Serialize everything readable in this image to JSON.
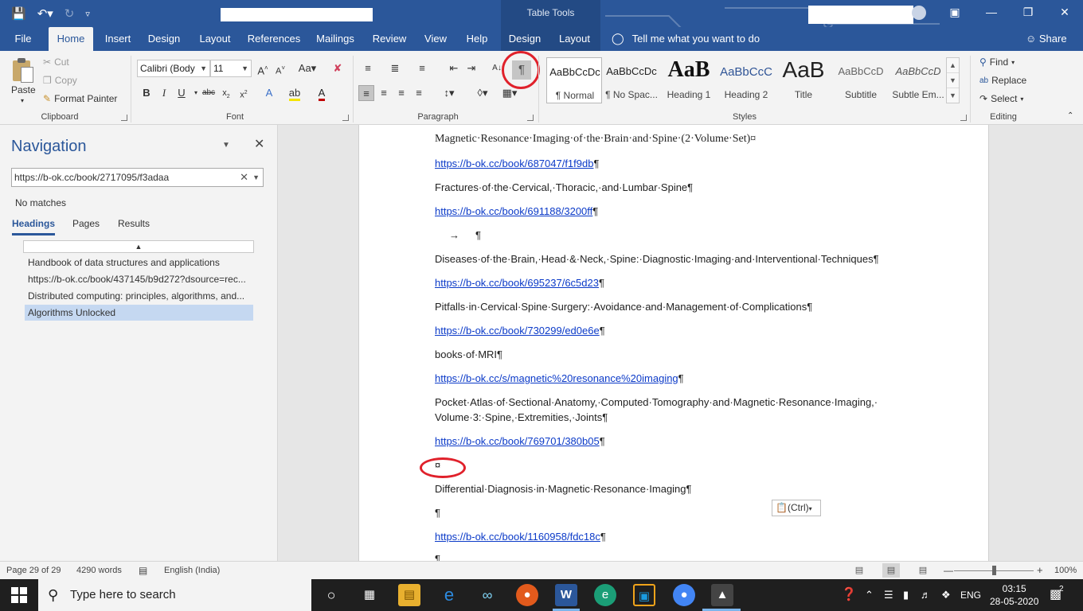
{
  "titlebar": {
    "context_group": "Table Tools",
    "undo_icon": "undo-icon",
    "redo_icon": "redo-icon"
  },
  "tabs": [
    "File",
    "Home",
    "Insert",
    "Design",
    "Layout",
    "References",
    "Mailings",
    "Review",
    "View",
    "Help",
    "Design",
    "Layout"
  ],
  "tell_me": "Tell me what you want to do",
  "share": "Share",
  "clipboard": {
    "paste": "Paste",
    "cut": "Cut",
    "copy": "Copy",
    "format_painter": "Format Painter",
    "label": "Clipboard"
  },
  "font": {
    "name": "Calibri (Body",
    "size": "11",
    "label": "Font"
  },
  "paragraph": {
    "label": "Paragraph",
    "show_marks": "¶"
  },
  "styles": {
    "label": "Styles",
    "items": [
      {
        "sample": "AaBbCcDc",
        "name": "¶ Normal"
      },
      {
        "sample": "AaBbCcDc",
        "name": "¶ No Spac..."
      },
      {
        "sample": "AaB",
        "name": "Heading 1"
      },
      {
        "sample": "AaBbCcC",
        "name": "Heading 2"
      },
      {
        "sample": "AaB",
        "name": "Title"
      },
      {
        "sample": "AaBbCcD",
        "name": "Subtitle"
      },
      {
        "sample": "AaBbCcD",
        "name": "Subtle Em..."
      }
    ]
  },
  "editing": {
    "find": "Find",
    "replace": "Replace",
    "select": "Select",
    "label": "Editing"
  },
  "navigation": {
    "title": "Navigation",
    "search_value": "https://b-ok.cc/book/2717095/f3adaa",
    "no_matches": "No matches",
    "tabs": [
      "Headings",
      "Pages",
      "Results"
    ],
    "headings": [
      "Handbook of data structures and applications",
      "https://b-ok.cc/book/437145/b9d272?dsource=rec...",
      "Distributed computing: principles, algorithms, and...",
      "Algorithms Unlocked"
    ]
  },
  "document": {
    "paragraphs": [
      {
        "text": "Magnetic·Resonance·Imaging·of·the·Brain·and·Spine·(2·Volume·Set)",
        "mark": "¤",
        "kind": "serif"
      },
      {
        "text": "https://b-ok.cc/book/687047/f1f9db",
        "mark": "¶",
        "kind": "link"
      },
      {
        "text": "Fractures·of·the·Cervical,·Thoracic,·and·Lumbar·Spine",
        "mark": "¶",
        "kind": "text"
      },
      {
        "text": "https://b-ok.cc/book/691188/3200ff",
        "mark": "¶",
        "kind": "link"
      },
      {
        "text": "→",
        "mark": "¶",
        "kind": "tab"
      },
      {
        "text": "Diseases·of·the·Brain,·Head·&·Neck,·Spine:·Diagnostic·Imaging·and·Interventional·Techniques",
        "mark": "¶",
        "kind": "text"
      },
      {
        "text": "https://b-ok.cc/book/695237/6c5d23",
        "mark": "¶",
        "kind": "link"
      },
      {
        "text": "Pitfalls·in·Cervical·Spine·Surgery:·Avoidance·and·Management·of·Complications",
        "mark": "¶",
        "kind": "text"
      },
      {
        "text": "https://b-ok.cc/book/730299/ed0e6e",
        "mark": "¶",
        "kind": "link"
      },
      {
        "text": "books·of·MRI",
        "mark": "¶",
        "kind": "text"
      },
      {
        "text": "https://b-ok.cc/s/magnetic%20resonance%20imaging",
        "mark": "¶",
        "kind": "link"
      },
      {
        "text": "Pocket·Atlas·of·Sectional·Anatomy,·Computed·Tomography·and·Magnetic·Resonance·Imaging,·",
        "mark": "",
        "kind": "text"
      },
      {
        "text": "Volume·3:·Spine,·Extremities,·Joints",
        "mark": "¶",
        "kind": "text"
      },
      {
        "text": "https://b-ok.cc/book/769701/380b05",
        "mark": "¶",
        "kind": "link"
      },
      {
        "text": "",
        "mark": "¤",
        "kind": "text"
      },
      {
        "text": "Differential·Diagnosis·in·Magnetic·Resonance·Imaging",
        "mark": "¶",
        "kind": "text"
      },
      {
        "text": "",
        "mark": "¶",
        "kind": "text"
      },
      {
        "text": "https://b-ok.cc/book/1160958/fdc18c",
        "mark": "¶",
        "kind": "link"
      },
      {
        "text": "",
        "mark": "¶",
        "kind": "text"
      }
    ],
    "paste_options": "(Ctrl)"
  },
  "status": {
    "page": "Page 29 of 29",
    "words": "4290 words",
    "language": "English (India)",
    "zoom": "100%",
    "zoom_fraction": 0.5
  },
  "taskbar": {
    "search_placeholder": "Type here to search",
    "tray_lang": "ENG",
    "time": "03:15",
    "date": "28-05-2020",
    "notifications": "2"
  },
  "colors": {
    "accent": "#2b579a",
    "link": "#0b3ac8",
    "highlight_ring": "#e0212b"
  }
}
